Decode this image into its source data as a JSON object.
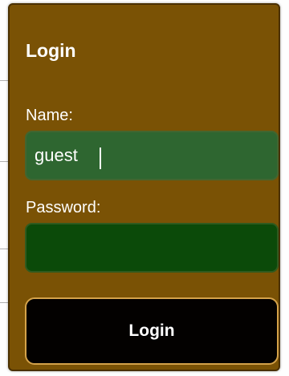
{
  "login_form": {
    "title": "Login",
    "name_label": "Name:",
    "name_value": "guest",
    "password_label": "Password:",
    "password_value": "",
    "submit_label": "Login"
  },
  "colors": {
    "panel": "#7a5205",
    "name_field": "#2e6630",
    "password_field": "#0b4a09",
    "button": "#030100",
    "button_border": "#d4a24a"
  }
}
